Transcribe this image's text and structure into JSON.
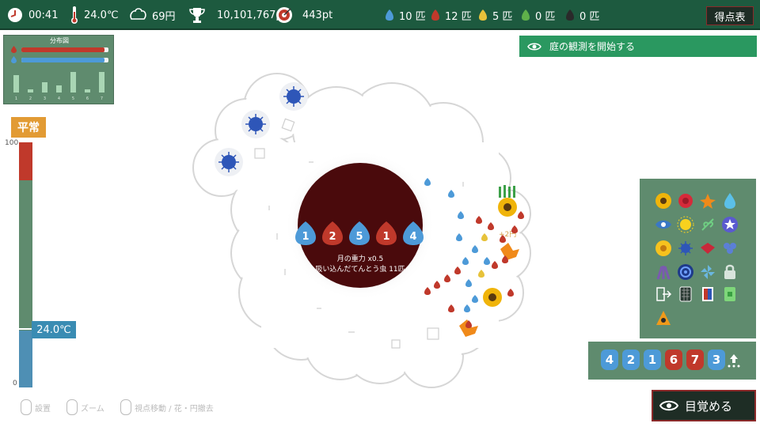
{
  "topbar": {
    "time": "00:41",
    "temperature": "24.0℃",
    "money": "69円",
    "trophy_score": "10,101,767pt",
    "target_score": "443pt",
    "bugs": [
      {
        "color": "#4d9ad8",
        "count": "10 匹"
      },
      {
        "color": "#c0392b",
        "count": "12 匹"
      },
      {
        "color": "#e7c23a",
        "count": "5 匹"
      },
      {
        "color": "#5fb04a",
        "count": "0 匹"
      },
      {
        "color": "#2a2a2a",
        "count": "0 匹"
      }
    ],
    "score_table_label": "得点表"
  },
  "distribution": {
    "title": "分布図",
    "red_value": 0.95,
    "blue_value": 0.95,
    "histogram": [
      5,
      1,
      3,
      2,
      6,
      1,
      6
    ],
    "histogram_labels": [
      "1",
      "2",
      "3",
      "4",
      "5",
      "6",
      "7"
    ]
  },
  "mood": {
    "label": "平常",
    "gauge_max": "100",
    "gauge_min": "0",
    "temperature": "24.0℃"
  },
  "observe_button": "庭の観測を開始する",
  "moon": {
    "bugs": [
      {
        "color": "#4d9ad8",
        "number": "1"
      },
      {
        "color": "#c0392b",
        "number": "2"
      },
      {
        "color": "#4d9ad8",
        "number": "5"
      },
      {
        "color": "#c0392b",
        "number": "1"
      },
      {
        "color": "#4d9ad8",
        "number": "4"
      }
    ],
    "gravity_text": "月の重力 x0.5",
    "absorbed_text": "吸い込んだてんとう虫 11匹"
  },
  "garden": {
    "bonus_text": "+2円"
  },
  "queue": {
    "items": [
      {
        "color": "#4d9ad8",
        "number": "4"
      },
      {
        "color": "#4d9ad8",
        "number": "2"
      },
      {
        "color": "#4d9ad8",
        "number": "1"
      },
      {
        "color": "#c0392b",
        "number": "6"
      },
      {
        "color": "#c0392b",
        "number": "7"
      },
      {
        "color": "#4d9ad8",
        "number": "3"
      }
    ]
  },
  "wake_button": "目覚める",
  "hints": [
    {
      "label": "設置"
    },
    {
      "label": "ズーム"
    },
    {
      "label": "視点移動 / 花・円撤去"
    }
  ]
}
